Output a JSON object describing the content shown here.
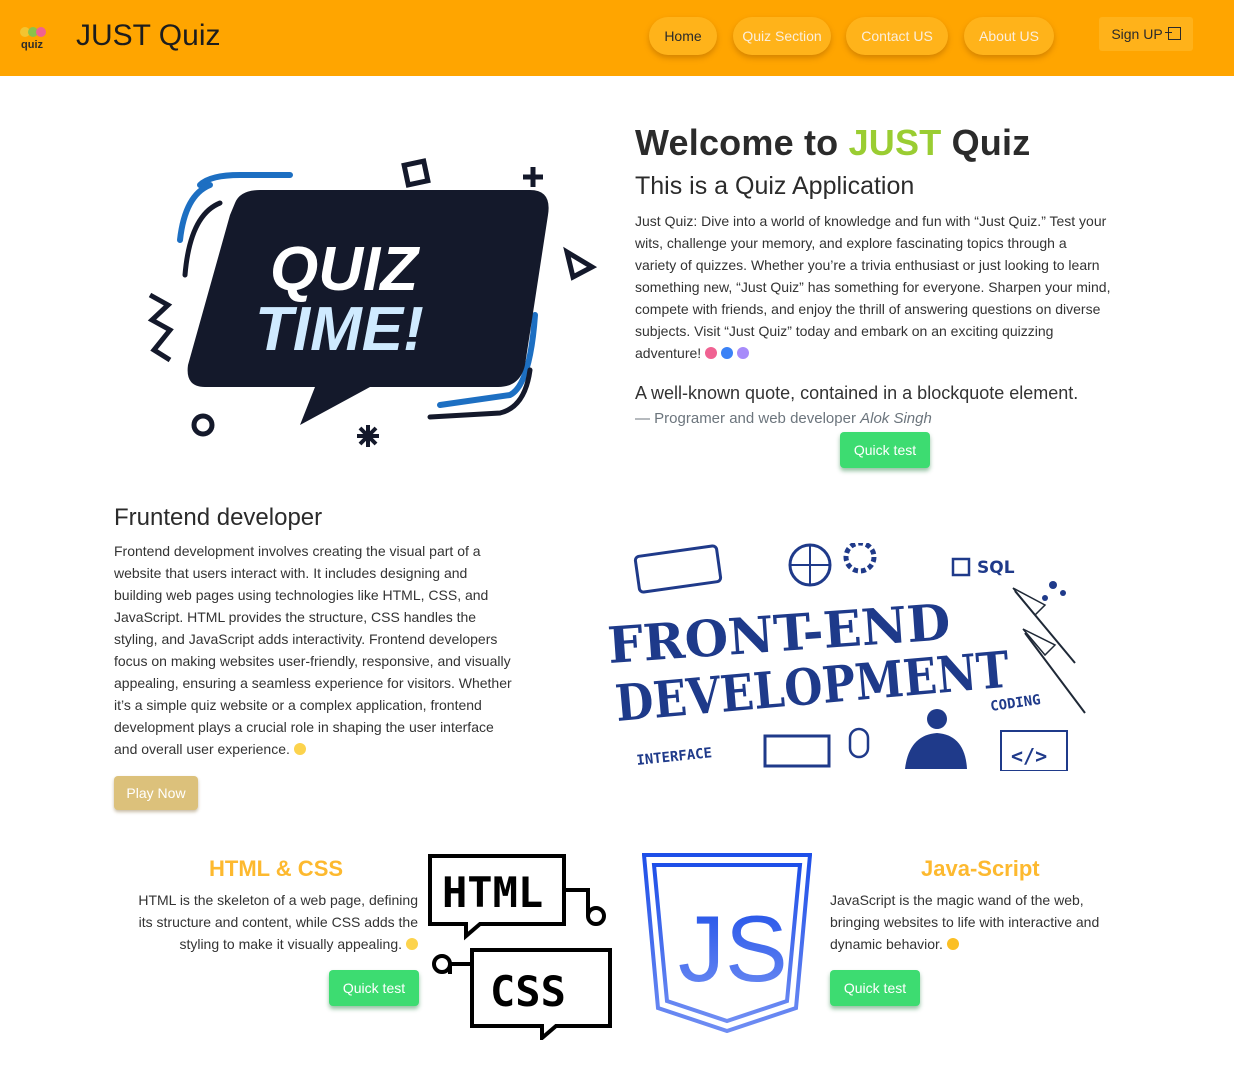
{
  "nav": {
    "logo_text": "quiz",
    "brand": "JUST Quiz",
    "items": [
      {
        "label": "Home",
        "active": true
      },
      {
        "label": "Quiz Section",
        "active": false
      },
      {
        "label": "Contact US",
        "active": false
      },
      {
        "label": "About US",
        "active": false
      }
    ],
    "signup_label": "Sign UP"
  },
  "hero": {
    "image_text_1": "QUIZ",
    "image_text_2": "TIME!",
    "title_before": "Welcome to ",
    "title_accent": "JUST",
    "title_after": " Quiz",
    "subtitle": "This is a Quiz Application",
    "paragraph_lines": [
      "Just Quiz: Dive into a world of knowledge and fun with “Just Quiz.” Test your",
      "wits, challenge your memory, and explore fascinating topics through a",
      "variety of quizzes. Whether you’re a trivia enthusiast or just looking to learn",
      "something new, “Just Quiz” has something for everyone. Sharpen your mind,",
      "compete with friends, and enjoy the thrill of answering questions on diverse",
      "subjects. Visit “Just Quiz” today and embark on an exciting quizzing",
      "adventure!"
    ],
    "quote": "A well-known quote, contained in a blockquote element.",
    "quote_source": "— Programer and web developer ",
    "quote_author": "Alok Singh",
    "button": "Quick test"
  },
  "frontend": {
    "title": "Fruntend developer",
    "paragraph_lines": [
      "Frontend development involves creating the visual part of a",
      "website that users interact with. It includes designing and",
      "building web pages using technologies like HTML, CSS, and",
      "JavaScript. HTML provides the structure, CSS handles the",
      "styling, and JavaScript adds interactivity. Frontend developers",
      "focus on making websites user-friendly, responsive, and visually",
      "appealing, ensuring a seamless experience for visitors. Whether",
      "it’s a simple quiz website or a complex application, frontend",
      "development plays a crucial role in shaping the user interface",
      "and overall user experience."
    ],
    "button": "Play Now",
    "image_words": {
      "front": "FRONT-END",
      "dev": "DEVELOPMENT",
      "sql": "SQL",
      "coding": "CODING",
      "interface": "INTERFACE",
      "tag": "</>"
    }
  },
  "html_card": {
    "title": "HTML & CSS",
    "paragraph_lines": [
      "HTML is the skeleton of a web page, defining",
      "its structure and content, while CSS adds the",
      "styling to make it visually appealing."
    ],
    "button": "Quick test",
    "image_text_1": "HTML",
    "image_text_2": "CSS"
  },
  "js_card": {
    "title": "Java-Script",
    "paragraph_lines": [
      "JavaScript is the magic wand of the web,",
      "bringing websites to life with interactive and",
      "dynamic behavior."
    ],
    "button": "Quick test",
    "image_text": "JS"
  },
  "colors": {
    "navbar": "#ffa500",
    "accent_green": "#9acd32",
    "button_green": "#3ddc71",
    "button_tan": "#dcc17b",
    "card_title": "#fdb92f",
    "dark_navy": "#14192b",
    "js_blue": "#2e5bea"
  }
}
